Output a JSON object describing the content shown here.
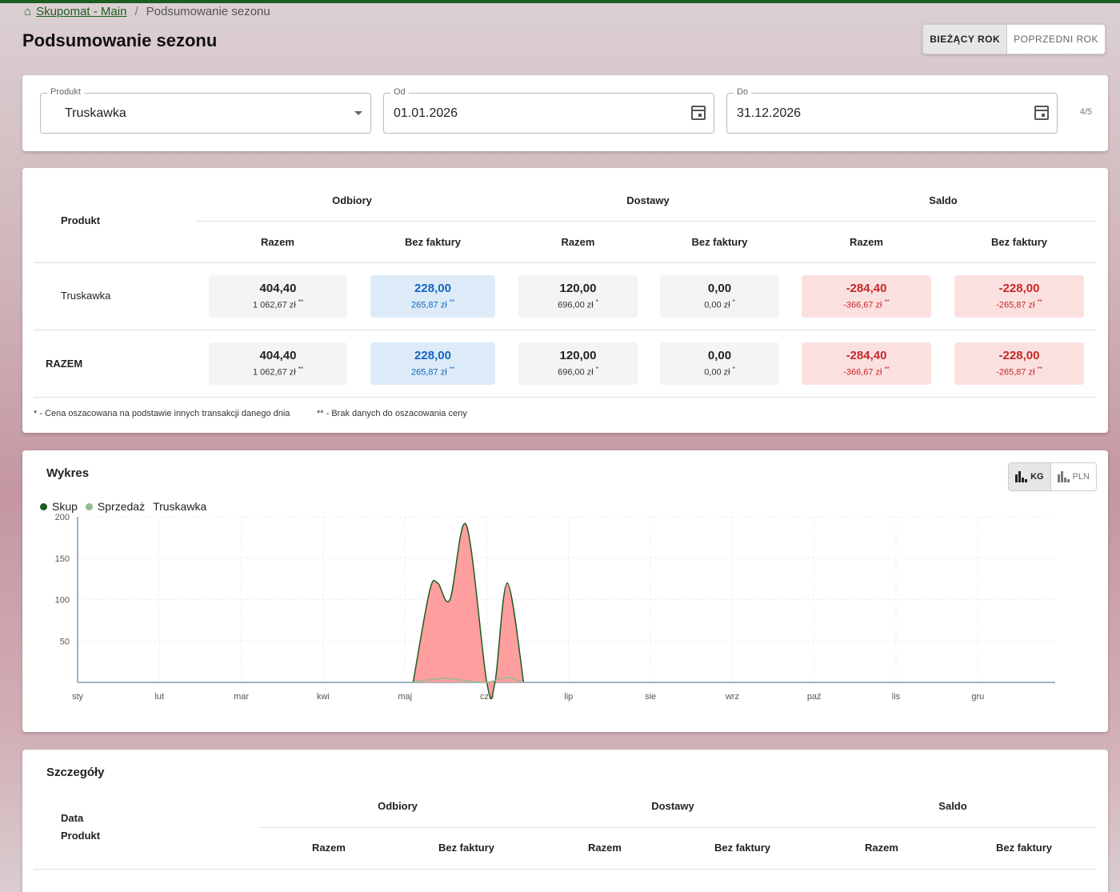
{
  "breadcrumb": {
    "home_link": "Skupomat - Main",
    "current": "Podsumowanie sezonu"
  },
  "page": {
    "title": "Podsumowanie sezonu"
  },
  "year_toggle": {
    "current": "BIEŻĄCY ROK",
    "previous": "POPRZEDNI ROK",
    "active": "current"
  },
  "filters": {
    "product": {
      "label": "Produkt",
      "value": "Truskawka"
    },
    "from": {
      "label": "Od",
      "value": "01.01.2026"
    },
    "to": {
      "label": "Do",
      "value": "31.12.2026"
    },
    "pager": "4/5"
  },
  "summary": {
    "headers": {
      "product": "Produkt",
      "groups": [
        "Odbiory",
        "Dostawy",
        "Saldo"
      ],
      "sub": [
        "Razem",
        "Bez faktury",
        "Razem",
        "Bez faktury",
        "Razem",
        "Bez faktury"
      ]
    },
    "rows": [
      {
        "label": "Truskawka",
        "cells": [
          {
            "main": "404,40",
            "sub": "1 062,67 zł",
            "mark": "**",
            "style": "grey"
          },
          {
            "main": "228,00",
            "sub": "265,87 zł",
            "mark": "**",
            "style": "blue"
          },
          {
            "main": "120,00",
            "sub": "696,00 zł",
            "mark": "*",
            "style": "grey"
          },
          {
            "main": "0,00",
            "sub": "0,00 zł",
            "mark": "*",
            "style": "grey"
          },
          {
            "main": "-284,40",
            "sub": "-366,67 zł",
            "mark": "**",
            "style": "red"
          },
          {
            "main": "-228,00",
            "sub": "-265,87 zł",
            "mark": "**",
            "style": "red"
          }
        ]
      },
      {
        "label": "RAZEM",
        "cells": [
          {
            "main": "404,40",
            "sub": "1 062,67 zł",
            "mark": "**",
            "style": "grey"
          },
          {
            "main": "228,00",
            "sub": "265,87 zł",
            "mark": "**",
            "style": "blue"
          },
          {
            "main": "120,00",
            "sub": "696,00 zł",
            "mark": "*",
            "style": "grey"
          },
          {
            "main": "0,00",
            "sub": "0,00 zł",
            "mark": "*",
            "style": "grey"
          },
          {
            "main": "-284,40",
            "sub": "-366,67 zł",
            "mark": "**",
            "style": "red"
          },
          {
            "main": "-228,00",
            "sub": "-265,87 zł",
            "mark": "**",
            "style": "red"
          }
        ]
      }
    ],
    "footnotes": [
      "* - Cena oszacowana na podstawie innych transakcji danego dnia",
      "** - Brak danych do oszacowania ceny"
    ]
  },
  "chart_section": {
    "title": "Wykres",
    "unit_toggle": {
      "kg": "KG",
      "pln": "PLN",
      "active": "kg"
    },
    "legend_product": "Truskawka"
  },
  "chart_data": {
    "type": "area",
    "categories": [
      "sty",
      "lut",
      "mar",
      "kwi",
      "maj",
      "cze",
      "lip",
      "sie",
      "wrz",
      "paź",
      "lis",
      "gru"
    ],
    "ylim": [
      0,
      200
    ],
    "yticks": [
      50,
      100,
      150,
      200
    ],
    "grid": true,
    "legend_placement": "top-left",
    "series": [
      {
        "name": "Skup",
        "color": "#1b5e20",
        "points": [
          [
            4.1,
            0
          ],
          [
            4.3,
            110
          ],
          [
            4.4,
            120
          ],
          [
            4.55,
            100
          ],
          [
            4.75,
            190
          ],
          [
            5.0,
            0
          ],
          [
            5.1,
            0
          ],
          [
            5.25,
            120
          ],
          [
            5.45,
            0
          ]
        ]
      },
      {
        "name": "Sprzedaż",
        "color": "#8fbc8f",
        "points": [
          [
            4.1,
            0
          ],
          [
            4.3,
            3
          ],
          [
            4.5,
            5
          ],
          [
            4.75,
            2
          ],
          [
            5.0,
            0
          ],
          [
            5.25,
            6
          ],
          [
            5.45,
            0
          ]
        ]
      }
    ],
    "fill_color": "#ff9e9e"
  },
  "details": {
    "title": "Szczegóły",
    "headers": {
      "date": "Data",
      "product": "Produkt",
      "groups": [
        "Odbiory",
        "Dostawy",
        "Saldo"
      ],
      "sub": [
        "Razem",
        "Bez faktury",
        "Razem",
        "Bez faktury",
        "Razem",
        "Bez faktury"
      ]
    }
  }
}
